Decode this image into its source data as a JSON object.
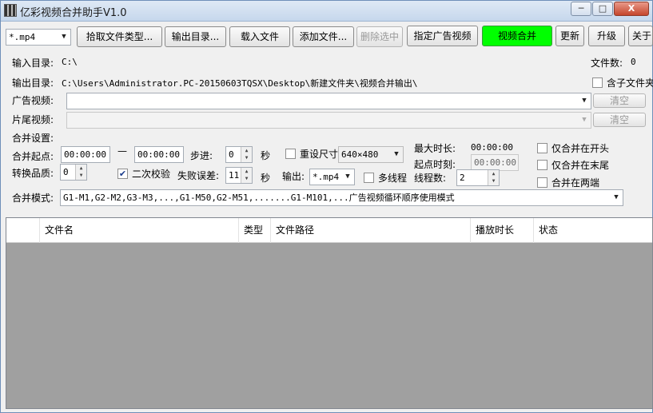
{
  "window": {
    "title": "亿彩视频合并助手V1.0",
    "minimize": "─",
    "maximize": "□",
    "close": "X"
  },
  "toolbar": {
    "filter_value": "*.mp4",
    "pick_types": "拾取文件类型...",
    "output_dir": "输出目录...",
    "load_files": "载入文件",
    "add_files": "添加文件...",
    "delete_selected": "删除选中",
    "set_ad_video": "指定广告视频",
    "merge_video": "视频合并",
    "refresh": "更新",
    "upgrade": "升级",
    "about": "关于"
  },
  "paths": {
    "input_label": "输入目录:",
    "input_value": "C:\\",
    "file_count_label": "文件数:",
    "file_count_value": "0",
    "output_label": "输出目录:",
    "output_value": "C:\\Users\\Administrator.PC-20150603TQSX\\Desktop\\新建文件夹\\视频合并输出\\",
    "subfolder_label": "含子文件夹",
    "ad_label": "广告视频:",
    "ad_clear": "清空",
    "tail_label": "片尾视频:",
    "tail_clear": "清空"
  },
  "merge": {
    "section_label": "合并设置:",
    "start_label": "合并起点:",
    "start_value": "00:00:00",
    "dash": "—",
    "end_value": "00:00:00",
    "step_label": "步进:",
    "step_value": "0",
    "sec1": "秒",
    "resize_label": "重设尺寸",
    "resize_value": "640×480",
    "max_duration_label": "最大时长:",
    "max_duration_value": "00:00:00",
    "only_start_label": "仅合并在开头",
    "quality_label": "转换品质:",
    "quality_value": "0",
    "recheck_label": "二次校验",
    "recheck_checked": "✔",
    "fail_error_label": "失败误差:",
    "fail_error_value": "11",
    "sec2": "秒",
    "output_label": "输出:",
    "output_format": "*.mp4",
    "multithread_label": "多线程",
    "thread_count_label": "线程数:",
    "thread_count_value": "2",
    "start_time_label": "起点时刻:",
    "start_time_value": "00:00:00",
    "only_end_label": "仅合并在末尾",
    "both_ends_label": "合并在两端",
    "mode_label": "合并模式:",
    "mode_value": "G1-M1,G2-M2,G3-M3,...,G1-M50,G2-M51,.......G1-M101,...广告视频循环顺序使用模式"
  },
  "table": {
    "columns": [
      "",
      "文件名",
      "类型",
      "文件路径",
      "播放时长",
      "状态"
    ],
    "rows": []
  }
}
